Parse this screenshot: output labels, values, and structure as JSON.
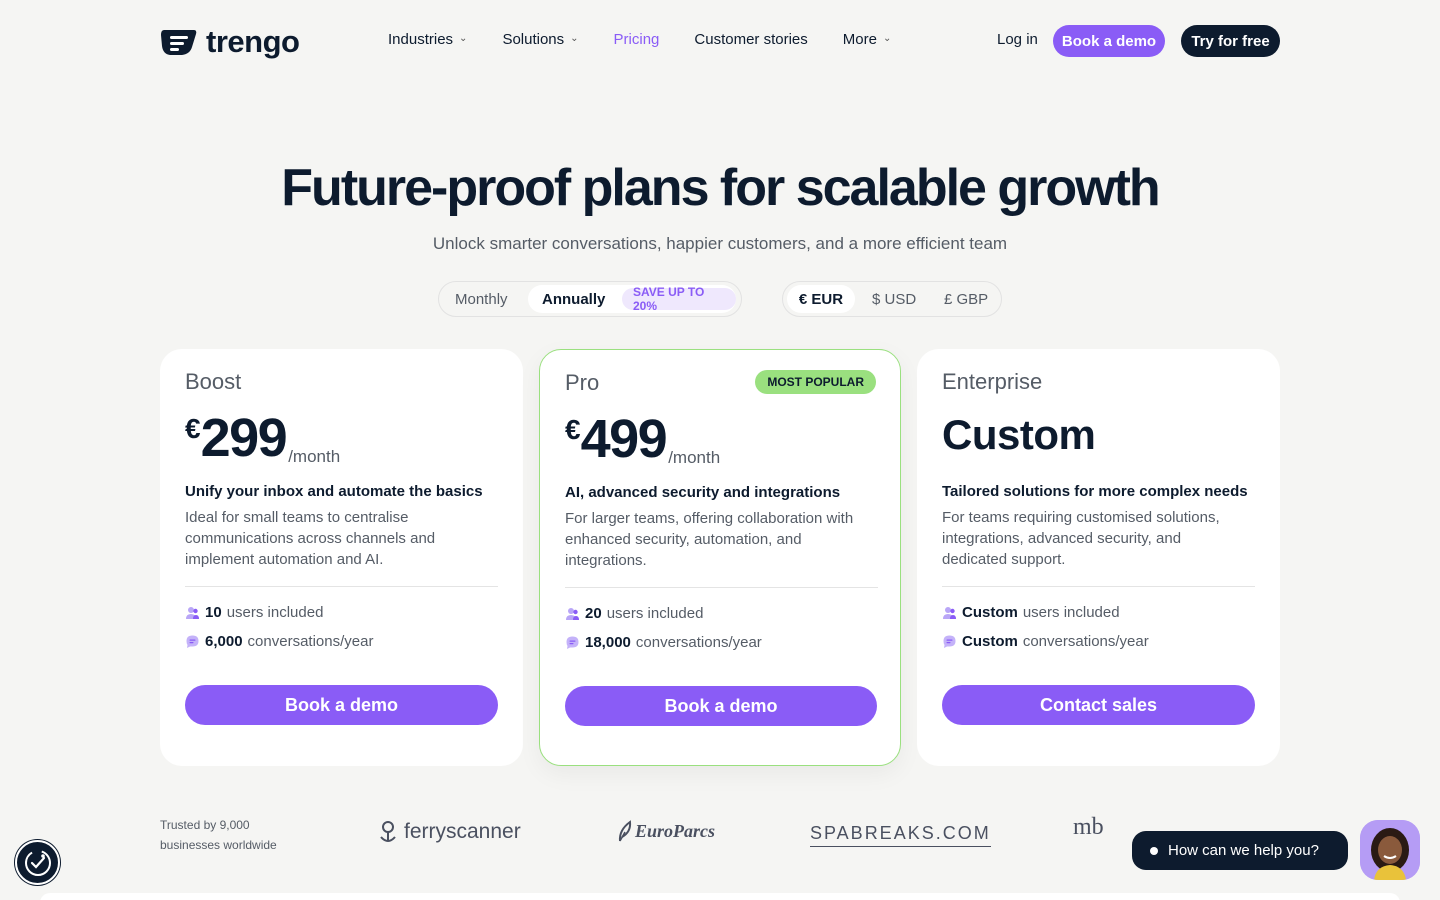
{
  "brand": {
    "logo_text": "trengo"
  },
  "nav": {
    "items": [
      {
        "label": "Industries",
        "dropdown": true,
        "active": false
      },
      {
        "label": "Solutions",
        "dropdown": true,
        "active": false
      },
      {
        "label": "Pricing",
        "dropdown": false,
        "active": true
      },
      {
        "label": "Customer stories",
        "dropdown": false,
        "active": false
      },
      {
        "label": "More",
        "dropdown": true,
        "active": false
      }
    ],
    "login_label": "Log in",
    "book_demo_label": "Book a demo",
    "try_free_label": "Try for free"
  },
  "hero": {
    "title": "Future-proof plans for scalable growth",
    "subtitle": "Unlock smarter conversations, happier customers, and a more efficient team"
  },
  "billing_toggle": {
    "monthly_label": "Monthly",
    "annually_label": "Annually",
    "save_badge": "SAVE UP TO 20%",
    "selected": "Annually"
  },
  "currency_toggle": {
    "options": [
      "€ EUR",
      "$ USD",
      "£ GBP"
    ],
    "selected": "€ EUR"
  },
  "plans": [
    {
      "name": "Boost",
      "currency_symbol": "€",
      "price": "299",
      "period": "/month",
      "tagline": "Unify your inbox and automate the basics",
      "description": "Ideal for small teams to centralise communications across channels and implement automation and AI.",
      "users_value": "10",
      "users_label": "users included",
      "conversations_value": "6,000",
      "conversations_label": "conversations/year",
      "cta": "Book a demo"
    },
    {
      "name": "Pro",
      "badge": "MOST POPULAR",
      "currency_symbol": "€",
      "price": "499",
      "period": "/month",
      "tagline": "AI, advanced security and integrations",
      "description": "For larger teams, offering collaboration with enhanced security, automation, and integrations.",
      "users_value": "20",
      "users_label": "users included",
      "conversations_value": "18,000",
      "conversations_label": "conversations/year",
      "cta": "Book a demo"
    },
    {
      "name": "Enterprise",
      "custom_price": "Custom",
      "tagline": "Tailored solutions for more complex needs",
      "description": "For teams requiring customised solutions, integrations, advanced security, and dedicated support.",
      "users_value": "Custom",
      "users_label": "users included",
      "conversations_value": "Custom",
      "conversations_label": "conversations/year",
      "cta": "Contact sales"
    }
  ],
  "trusted": {
    "line1": "Trusted by 9,000",
    "line2": "businesses worldwide",
    "logos": [
      "ferryscanner",
      "EuroParcs",
      "SPABREAKS.COM",
      "mb"
    ]
  },
  "chat": {
    "prompt": "How can we help you?"
  },
  "colors": {
    "accent": "#8a5cf6",
    "dark": "#0d1b2e",
    "popular_green": "#9ae07f",
    "background": "#f5f5f3"
  }
}
